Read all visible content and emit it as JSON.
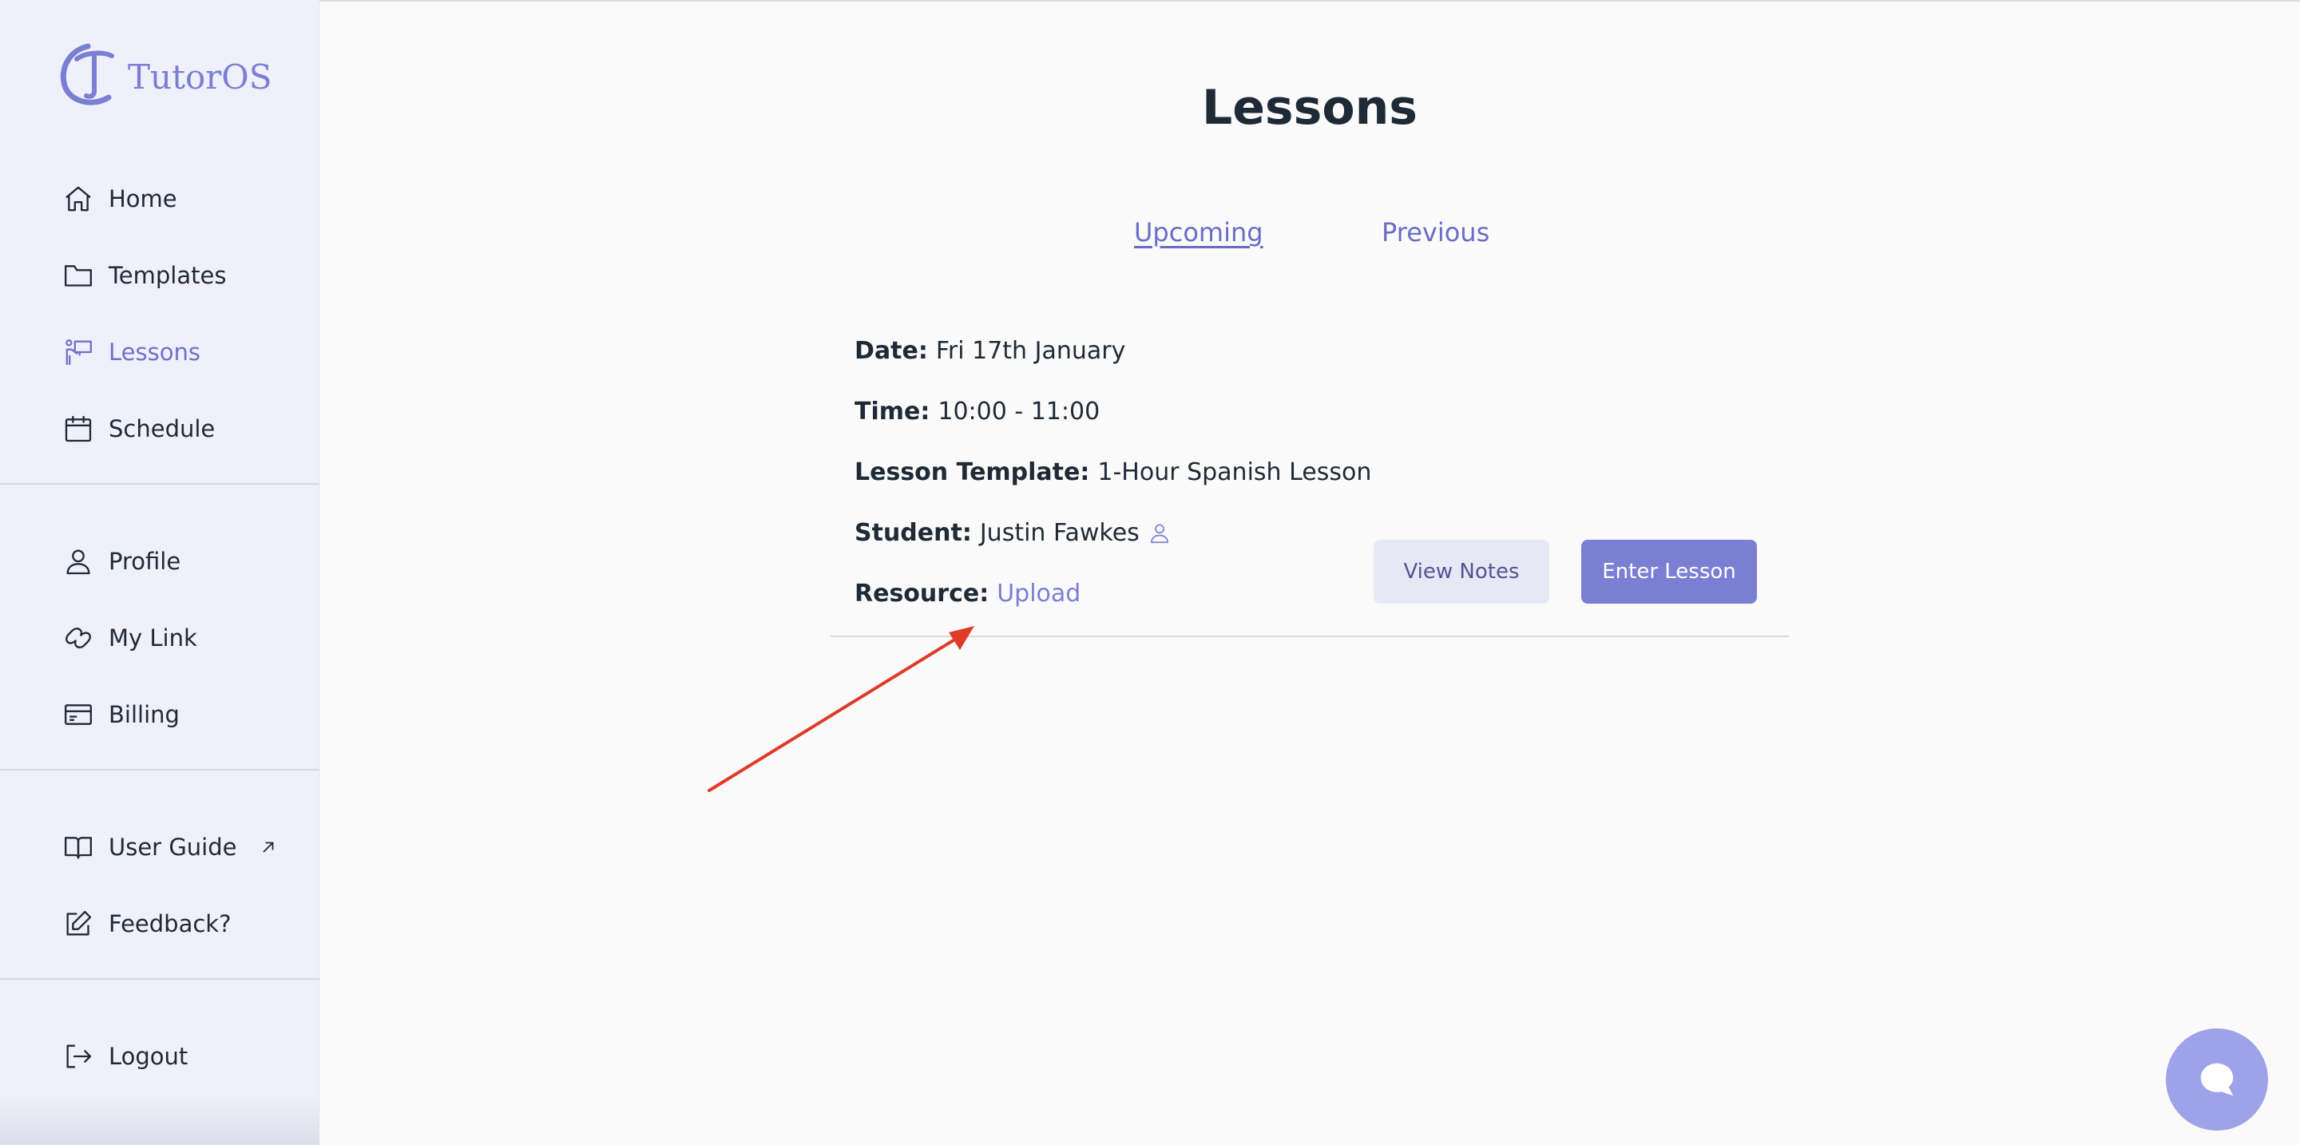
{
  "app": {
    "name": "TutorOS"
  },
  "sidebar": {
    "primary": [
      {
        "label": "Home",
        "icon": "home-icon"
      },
      {
        "label": "Templates",
        "icon": "folder-icon"
      },
      {
        "label": "Lessons",
        "icon": "teacher-board-icon",
        "active": true
      },
      {
        "label": "Schedule",
        "icon": "calendar-icon"
      }
    ],
    "account": [
      {
        "label": "Profile",
        "icon": "user-icon"
      },
      {
        "label": "My Link",
        "icon": "link-icon"
      },
      {
        "label": "Billing",
        "icon": "credit-card-icon"
      }
    ],
    "help": [
      {
        "label": "User Guide",
        "icon": "book-icon",
        "external": true
      },
      {
        "label": "Feedback?",
        "icon": "edit-icon"
      }
    ],
    "logout": {
      "label": "Logout",
      "icon": "logout-icon"
    }
  },
  "main": {
    "title": "Lessons",
    "tabs": [
      {
        "label": "Upcoming",
        "active": true
      },
      {
        "label": "Previous",
        "active": false
      }
    ],
    "lesson": {
      "date": {
        "label": "Date:",
        "value": "Fri 17th January"
      },
      "time": {
        "label": "Time:",
        "value": "10:00 - 11:00"
      },
      "template": {
        "label": "Lesson Template:",
        "value": "1-Hour Spanish Lesson"
      },
      "student": {
        "label": "Student:",
        "value": "Justin Fawkes"
      },
      "resource": {
        "label": "Resource:",
        "value": "Upload"
      },
      "view_notes": "View Notes",
      "enter_lesson": "Enter Lesson"
    }
  },
  "colors": {
    "accent": "#7b7fd3",
    "sidebar_bg": "#eff0fa",
    "annotation": "#e03a28",
    "chat_button": "#9da2e9"
  }
}
